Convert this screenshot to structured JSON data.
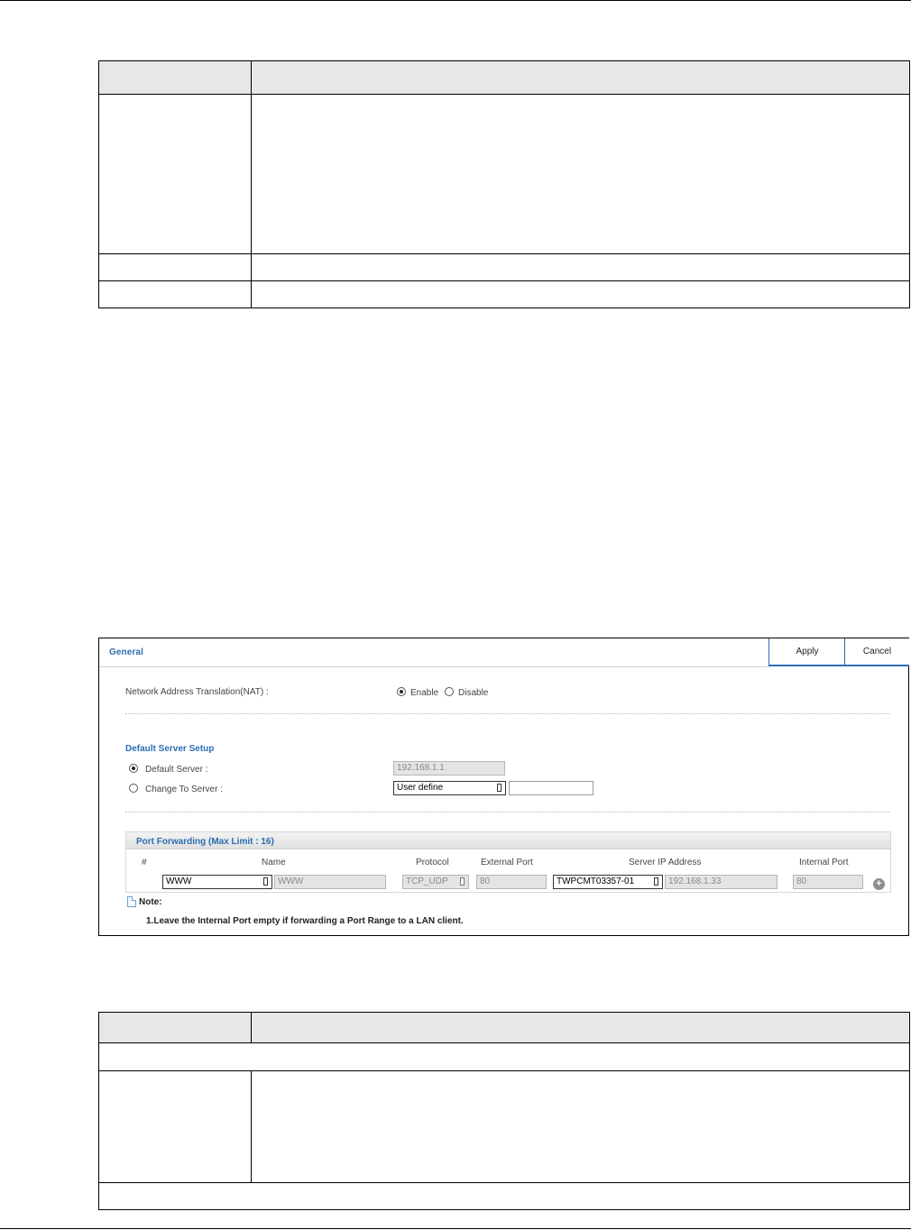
{
  "settings": {
    "title": "General",
    "apply_label": "Apply",
    "cancel_label": "Cancel",
    "nat_label": "Network Address Translation(NAT) :",
    "nat_enable": "Enable",
    "nat_disable": "Disable",
    "nat_selected": "Enable",
    "default_server_section": "Default Server Setup",
    "default_server_label": "Default Server :",
    "default_server_value": "192.168.1.1",
    "change_server_label": "Change To Server :",
    "change_server_select": "User define",
    "change_server_input": "",
    "port_forwarding_title": "Port Forwarding (Max Limit : 16)",
    "columns": [
      "#",
      "Name",
      "Protocol",
      "External Port",
      "Server IP Address",
      "Internal Port"
    ],
    "row": {
      "name_select": "WWW",
      "name_value": "WWW",
      "protocol": "TCP_UDP",
      "external_port": "80",
      "server_select": "TWPCMT03357-01",
      "server_ip": "192.168.1.33",
      "internal_port": "80"
    },
    "note_label": "Note:",
    "note_text": "1.Leave the Internal Port empty if forwarding a Port Range to a LAN client."
  }
}
